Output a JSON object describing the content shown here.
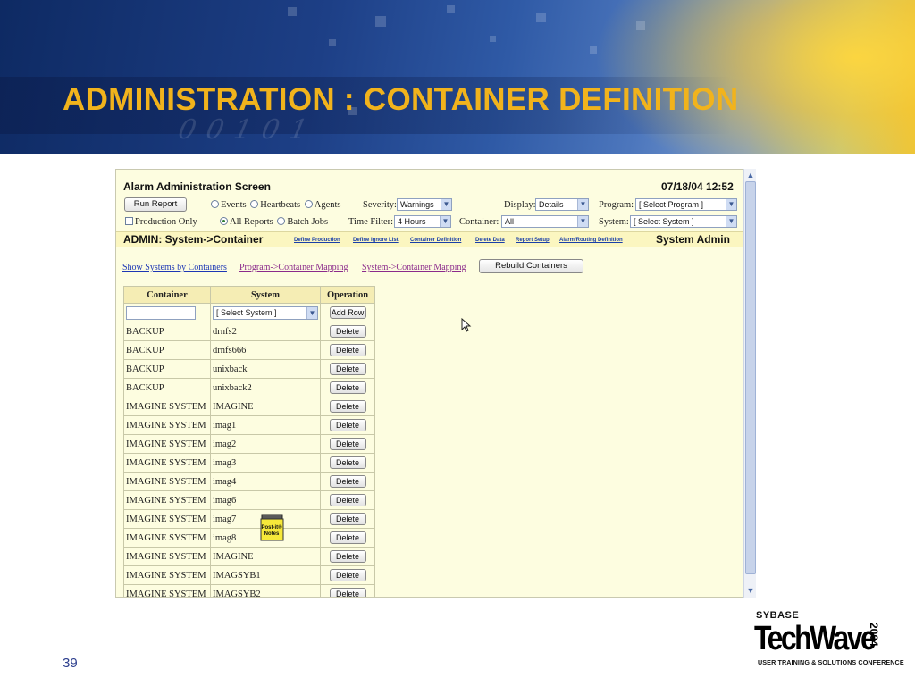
{
  "slide": {
    "title": "ADMINISTRATION : CONTAINER DEFINITION",
    "page_number": "39",
    "banner_digits": "00101",
    "colors": {
      "title": "#f1b31c",
      "banner_dark": "#0e2a63",
      "banner_glow": "#e8c43b",
      "page_number": "#2d3f8e"
    }
  },
  "logo": {
    "brand": "SYBASE",
    "product": "TechWave",
    "year": "2004",
    "tagline": "USER TRAINING & SOLUTIONS CONFERENCE"
  },
  "app": {
    "screen_title": "Alarm Administration Screen",
    "datetime": "07/18/04 12:52",
    "run_report_label": "Run Report",
    "radio_events": "Events",
    "radio_heartbeats": "Heartbeats",
    "radio_agents": "Agents",
    "severity_label": "Severity:",
    "severity_value": "Warnings",
    "display_label": "Display:",
    "display_value": "Details",
    "program_label": "Program:",
    "program_value": "[ Select Program ]",
    "production_only_label": "Production Only",
    "radio_all_reports": "All Reports",
    "radio_batch_jobs": "Batch Jobs",
    "time_filter_label": "Time Filter:",
    "time_filter_value": "4 Hours",
    "container_label": "Container:",
    "container_value": "All",
    "system_label": "System:",
    "system_value": "[ Select System ]"
  },
  "admin_bar": {
    "breadcrumb": "ADMIN: System->Container",
    "links": [
      "Define Production",
      "Define Ignore List",
      "Container Definition",
      "Delete Data",
      "Report Setup",
      "Alarm/Routing Definition"
    ],
    "role": "System Admin"
  },
  "sub_links": {
    "show_systems": "Show Systems by Containers",
    "program_mapping": "Program->Container Mapping",
    "system_mapping": "System->Container Mapping",
    "rebuild_label": "Rebuild Containers"
  },
  "table": {
    "headers": [
      "Container",
      "System",
      "Operation"
    ],
    "new_row_system_placeholder": "[ Select System ]",
    "add_row_label": "Add Row",
    "delete_label": "Delete",
    "rows": [
      [
        "BACKUP",
        "drnfs2"
      ],
      [
        "BACKUP",
        "drnfs666"
      ],
      [
        "BACKUP",
        "unixback"
      ],
      [
        "BACKUP",
        "unixback2"
      ],
      [
        "IMAGINE SYSTEM",
        "IMAGINE"
      ],
      [
        "IMAGINE SYSTEM",
        "imag1"
      ],
      [
        "IMAGINE SYSTEM",
        "imag2"
      ],
      [
        "IMAGINE SYSTEM",
        "imag3"
      ],
      [
        "IMAGINE SYSTEM",
        "imag4"
      ],
      [
        "IMAGINE SYSTEM",
        "imag6"
      ],
      [
        "IMAGINE SYSTEM",
        "imag7"
      ],
      [
        "IMAGINE SYSTEM",
        "imag8"
      ],
      [
        "IMAGINE SYSTEM",
        "IMAGINE"
      ],
      [
        "IMAGINE SYSTEM",
        "IMAGSYB1"
      ],
      [
        "IMAGINE SYSTEM",
        "IMAGSYB2"
      ]
    ]
  },
  "desktop_icon": {
    "label_line1": "Post-it®",
    "label_line2": "Notes"
  },
  "icons": {
    "cursor": "mouse-pointer-icon",
    "dropdown": "chevron-down-icon",
    "postit": "post-it-notes-icon"
  }
}
